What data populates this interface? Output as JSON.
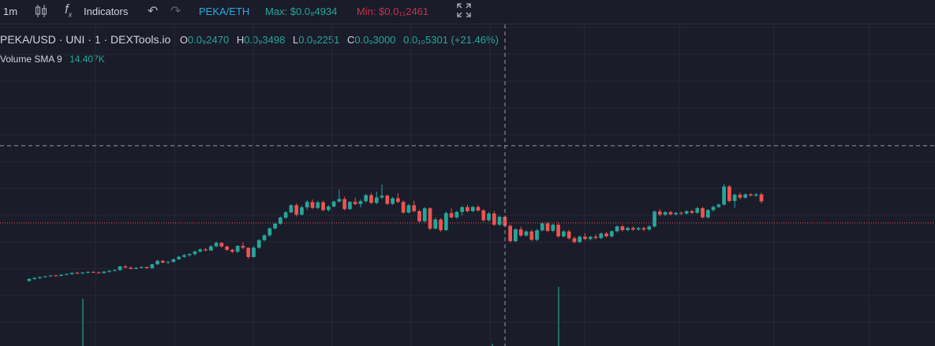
{
  "toolbar": {
    "interval": "1m",
    "candle_icon": "candlestick-icon",
    "fx_icon": "function-icon",
    "indicators_label": "Indicators",
    "undo_icon": "undo-icon",
    "redo_icon": "redo-icon",
    "pair_eth": "PEKA/ETH",
    "max_label": "Max: $0.0₈4934",
    "min_label": "Min: $0.0₁₁2461",
    "fullscreen_icon": "fullscreen-icon"
  },
  "legend": {
    "title": "PEKA/USD · UNI · 1 · DEXTools.io",
    "o_label": "O",
    "o_value": "0.0₉2470",
    "h_label": "H",
    "h_value": "0.0₉3498",
    "l_label": "L",
    "l_value": "0.0₉2251",
    "c_label": "C",
    "c_value": "0.0₉3000",
    "change": "0.0₁₀5301 (+21.46%)",
    "volume_label": "Volume SMA 9",
    "volume_value": "14.407K"
  },
  "colors": {
    "background": "#1a1c29",
    "grid": "#262938",
    "up": "#26a69a",
    "down": "#ef5350",
    "crosshair": "#9598a1",
    "volume": "#1f6e66"
  },
  "chart_data": {
    "type": "candlestick",
    "y_scale": "relative",
    "ylim": [
      0,
      100
    ],
    "grid": true,
    "crosshair_price": 78,
    "last_price": 38,
    "candles": [
      [
        8,
        9.5,
        7.5,
        9
      ],
      [
        9,
        10,
        8.5,
        9.5
      ],
      [
        9.5,
        10.2,
        9,
        10
      ],
      [
        10,
        10.6,
        9.6,
        10.4
      ],
      [
        10.4,
        11,
        10,
        10.8
      ],
      [
        10.8,
        11.2,
        10.3,
        10.6
      ],
      [
        10.6,
        11.5,
        10.4,
        11.2
      ],
      [
        11.2,
        11.9,
        10.9,
        11.6
      ],
      [
        11.6,
        12.4,
        11.2,
        12.2
      ],
      [
        12.2,
        12.8,
        11.6,
        11.9
      ],
      [
        11.9,
        12.6,
        11.5,
        12.3
      ],
      [
        12.3,
        13,
        11.8,
        12.6
      ],
      [
        12.6,
        13.2,
        12.2,
        12.4
      ],
      [
        12.4,
        12.9,
        11.9,
        12.1
      ],
      [
        12.1,
        13.1,
        11.8,
        12.8
      ],
      [
        12.8,
        13.5,
        12.3,
        13.3
      ],
      [
        13.3,
        14,
        12.9,
        13.6
      ],
      [
        13.6,
        15.8,
        13.2,
        15.5
      ],
      [
        15.5,
        16.2,
        14.6,
        14.9
      ],
      [
        14.9,
        15.3,
        14,
        14.3
      ],
      [
        14.3,
        15,
        13.9,
        14.8
      ],
      [
        14.8,
        15.6,
        14.3,
        15.2
      ],
      [
        15.2,
        15.4,
        14.3,
        14.6
      ],
      [
        14.6,
        16.9,
        14.2,
        16.6
      ],
      [
        16.6,
        19,
        16.2,
        18.4
      ],
      [
        18.4,
        18.9,
        17.1,
        17.5
      ],
      [
        17.5,
        18.2,
        16.7,
        17.9
      ],
      [
        17.9,
        19.6,
        17.5,
        19.2
      ],
      [
        19.2,
        21,
        18.7,
        20.5
      ],
      [
        20.5,
        22,
        19.9,
        21.3
      ],
      [
        21.3,
        22.4,
        20.6,
        21.9
      ],
      [
        21.9,
        23.8,
        21.2,
        23.2
      ],
      [
        23.2,
        24.9,
        22.6,
        24.3
      ],
      [
        24.3,
        25.1,
        23.3,
        23.8
      ],
      [
        23.8,
        26.5,
        23.4,
        25.9
      ],
      [
        25.9,
        28.4,
        25.4,
        27.7
      ],
      [
        27.7,
        28.1,
        25.2,
        25.8
      ],
      [
        25.8,
        26.4,
        23.5,
        24.1
      ],
      [
        24.1,
        24.6,
        22.4,
        23.1
      ],
      [
        23.1,
        26.6,
        22.5,
        26.1
      ],
      [
        26.1,
        27.9,
        24.5,
        25.2
      ],
      [
        25.2,
        24.8,
        19.5,
        20.4
      ],
      [
        20.4,
        26,
        20,
        25.2
      ],
      [
        25.2,
        29.7,
        24.7,
        29.1
      ],
      [
        29.1,
        32.1,
        28.6,
        31.6
      ],
      [
        31.6,
        35.8,
        30.9,
        35.2
      ],
      [
        35.2,
        38.2,
        34.6,
        37.6
      ],
      [
        37.6,
        41.3,
        37.1,
        40.8
      ],
      [
        40.8,
        44.2,
        40.1,
        43.5
      ],
      [
        43.5,
        47.8,
        43,
        47.2
      ],
      [
        47.2,
        48.1,
        41.4,
        42.3
      ],
      [
        42.3,
        46.9,
        41.9,
        46.1
      ],
      [
        46.1,
        49.8,
        44.7,
        48.9
      ],
      [
        48.9,
        50.2,
        45.2,
        45.8
      ],
      [
        45.8,
        49.6,
        45.1,
        48.7
      ],
      [
        48.7,
        49.5,
        44.1,
        44.7
      ],
      [
        44.7,
        47.3,
        43.9,
        46.5
      ],
      [
        46.5,
        49.6,
        46.1,
        49.1
      ],
      [
        49.1,
        55.2,
        48.6,
        50.4
      ],
      [
        50.4,
        51.6,
        44.6,
        45.2
      ],
      [
        45.2,
        49.4,
        44.8,
        48.9
      ],
      [
        48.9,
        51.1,
        47.2,
        47.8
      ],
      [
        47.8,
        50.2,
        46.1,
        49.3
      ],
      [
        49.3,
        53,
        48.5,
        52.4
      ],
      [
        52.4,
        53.6,
        47.9,
        48.4
      ],
      [
        48.4,
        54.1,
        47.7,
        51.2
      ],
      [
        51.2,
        57.9,
        50.4,
        52.1
      ],
      [
        52.1,
        52.7,
        47.3,
        47.9
      ],
      [
        47.9,
        51.4,
        47.3,
        50.8
      ],
      [
        50.8,
        53.4,
        48.2,
        48.9
      ],
      [
        48.9,
        49.6,
        42.8,
        43.4
      ],
      [
        43.4,
        47.9,
        42.9,
        47.2
      ],
      [
        47.2,
        49.5,
        43.4,
        44.1
      ],
      [
        44.1,
        45,
        38.2,
        38.9
      ],
      [
        38.9,
        46.2,
        38.3,
        45.6
      ],
      [
        45.6,
        46.1,
        34.2,
        35.1
      ],
      [
        35.1,
        40.9,
        34.6,
        39.8
      ],
      [
        39.8,
        40.4,
        33.5,
        34.3
      ],
      [
        34.3,
        43.9,
        33.8,
        43.1
      ],
      [
        43.1,
        45.6,
        40.3,
        40.9
      ],
      [
        40.9,
        44.3,
        40.2,
        43.7
      ],
      [
        43.7,
        46.8,
        41.9,
        46.2
      ],
      [
        46.2,
        47.5,
        43.4,
        44.1
      ],
      [
        44.1,
        46.9,
        43.6,
        46.3
      ],
      [
        46.3,
        47.1,
        43.8,
        44.5
      ],
      [
        44.5,
        45.2,
        38.7,
        39.4
      ],
      [
        39.4,
        43.7,
        38.8,
        42.9
      ],
      [
        42.9,
        44.2,
        36.4,
        37.1
      ],
      [
        37.1,
        41.8,
        36.5,
        41.2
      ],
      [
        41.2,
        41.9,
        35.8,
        36.5
      ],
      [
        36.5,
        37.2,
        27.9,
        28.6
      ],
      [
        28.6,
        35.3,
        28,
        34.7
      ],
      [
        34.7,
        36.1,
        30.8,
        31.5
      ],
      [
        31.5,
        34.2,
        30.9,
        33.6
      ],
      [
        33.6,
        34.4,
        28.7,
        29.3
      ],
      [
        29.3,
        34.9,
        28.7,
        34.2
      ],
      [
        34.2,
        38.4,
        33.6,
        37.8
      ],
      [
        37.8,
        38.6,
        33.2,
        33.9
      ],
      [
        33.9,
        37.7,
        33.3,
        37.1
      ],
      [
        37.1,
        38.2,
        30.4,
        31.1
      ],
      [
        31.1,
        34.3,
        30.5,
        33.6
      ],
      [
        33.6,
        34.5,
        29.3,
        30.1
      ],
      [
        30.1,
        31,
        27.4,
        28.1
      ],
      [
        28.1,
        31.6,
        27.5,
        30.9
      ],
      [
        30.9,
        32.7,
        29.1,
        29.7
      ],
      [
        29.7,
        31.4,
        29,
        30.8
      ],
      [
        30.8,
        32.1,
        29.6,
        30.2
      ],
      [
        30.2,
        33.1,
        29.6,
        32.5
      ],
      [
        32.5,
        33.4,
        30.4,
        31.1
      ],
      [
        31.1,
        34.2,
        30.5,
        33.7
      ],
      [
        33.7,
        36.8,
        33.1,
        36.2
      ],
      [
        36.2,
        37,
        33.6,
        34.3
      ],
      [
        34.3,
        36.1,
        33.7,
        35.4
      ],
      [
        35.4,
        36.2,
        33.9,
        34.6
      ],
      [
        34.6,
        36,
        34,
        35.3
      ],
      [
        35.3,
        36.1,
        33.9,
        34.6
      ],
      [
        34.6,
        36.8,
        34,
        36.2
      ],
      [
        36.2,
        44.5,
        35.6,
        43.9
      ],
      [
        43.9,
        45.2,
        41.5,
        42.3
      ],
      [
        42.3,
        44.2,
        41.7,
        43.6
      ],
      [
        43.6,
        44.3,
        41.8,
        42.5
      ],
      [
        42.5,
        43.8,
        41.9,
        43.2
      ],
      [
        43.2,
        44,
        42.1,
        42.9
      ],
      [
        42.9,
        44.6,
        42.3,
        44.1
      ],
      [
        44.1,
        44.9,
        42.6,
        43.3
      ],
      [
        43.3,
        46.3,
        42.7,
        45.7
      ],
      [
        45.7,
        46.4,
        40.2,
        40.9
      ],
      [
        40.9,
        45.3,
        40.3,
        44.7
      ],
      [
        44.7,
        46.9,
        43.9,
        46.3
      ],
      [
        46.3,
        48.1,
        45.7,
        47.5
      ],
      [
        47.5,
        58.3,
        47,
        56.9
      ],
      [
        56.9,
        57.6,
        48.7,
        49.4
      ],
      [
        49.4,
        53.2,
        45.8,
        52.6
      ],
      [
        52.6,
        53.7,
        50.2,
        51.1
      ],
      [
        51.1,
        53.4,
        50.5,
        52.8
      ],
      [
        52.8,
        53.4,
        51.7,
        52.2
      ],
      [
        52.2,
        53.5,
        51.5,
        52.8
      ],
      [
        52.8,
        53.6,
        48.1,
        49.2
      ]
    ],
    "volume": [
      0,
      0,
      0,
      0,
      0,
      0,
      0,
      0,
      0,
      0,
      0,
      0,
      0,
      0,
      0,
      0,
      0,
      0,
      0,
      0,
      0,
      0,
      0,
      0,
      0,
      0,
      0,
      0,
      0,
      0,
      0,
      0,
      0,
      0,
      0,
      0,
      0,
      0,
      0,
      0,
      0,
      0,
      0,
      0,
      0,
      0,
      0,
      0,
      0,
      0,
      0,
      0,
      0,
      0,
      0,
      0,
      0,
      0,
      0,
      0,
      0,
      0,
      0,
      0,
      0,
      0,
      0,
      0,
      0,
      0,
      0,
      0,
      0,
      0,
      0,
      0,
      0,
      0,
      0,
      0,
      0,
      0,
      0,
      0,
      0,
      0,
      0,
      0,
      0,
      0,
      0,
      0,
      0,
      0,
      0,
      0,
      0,
      0,
      0,
      0,
      0,
      0,
      0,
      0,
      0,
      0,
      0,
      0,
      0,
      0,
      0,
      0,
      0,
      0,
      0,
      0,
      0,
      0,
      0,
      0,
      0,
      0,
      0,
      0,
      0,
      0,
      0,
      0,
      0,
      0,
      0,
      0,
      0,
      0,
      0,
      0,
      0,
      0
    ]
  }
}
